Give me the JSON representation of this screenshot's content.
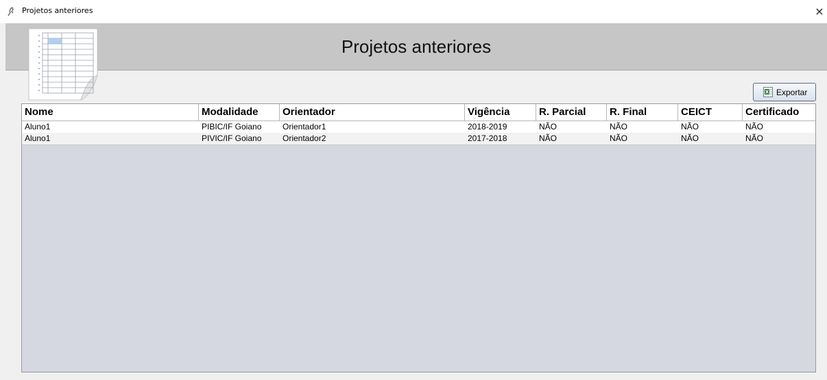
{
  "window": {
    "title": "Projetos anteriores",
    "close_glyph": "×",
    "icon": "app-icon"
  },
  "banner": {
    "title": "Projetos anteriores",
    "icon": "spreadsheet-document-icon"
  },
  "toolbar": {
    "export_label": "Exportar",
    "export_icon": "excel-icon"
  },
  "table": {
    "columns": [
      "Nome",
      "Modalidade",
      "Orientador",
      "Vigência",
      "R. Parcial",
      "R. Final",
      "CEICT",
      "Certificado"
    ],
    "rows": [
      [
        "Aluno1",
        "PIBIC/IF Goiano",
        "Orientador1",
        "2018-2019",
        "NÃO",
        "NÃO",
        "NÃO",
        "NÃO"
      ],
      [
        "Aluno1",
        "PIVIC/IF Goiano",
        "Orientador2",
        "2017-2018",
        "NÃO",
        "NÃO",
        "NÃO",
        "NÃO"
      ]
    ]
  },
  "colors": {
    "banner": "#c6c6c6",
    "table_empty_area": "#d5d8e0",
    "button_border": "#5b6b84"
  }
}
